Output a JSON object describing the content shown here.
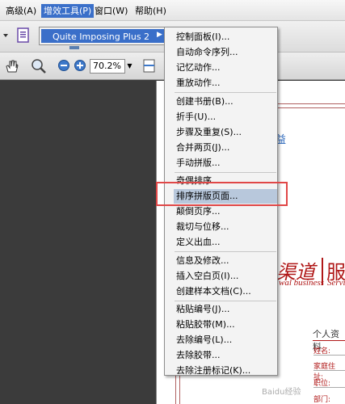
{
  "menubar": {
    "items": [
      "高级(A)",
      "增效工具(P)",
      "窗口(W)",
      "帮助(H)"
    ]
  },
  "toolbar": {
    "zoom_value": "70.2%"
  },
  "submenu": {
    "label": "Quite Imposing Plus 2"
  },
  "menu": {
    "groups": [
      [
        "控制面板(I)...",
        "自动命令序列...",
        "记忆动作...",
        "重放动作..."
      ],
      [
        "创建书册(B)...",
        "折手(U)...",
        "步骤及重复(S)...",
        "合并两页(J)...",
        "手动拼版..."
      ],
      [
        "奇偶排序...",
        "排序拼版页面...",
        "颠倒页序...",
        "裁切与位移...",
        "定义出血..."
      ],
      [
        "信息及修改...",
        "插入空白页(I)...",
        "创建样本文档(C)..."
      ],
      [
        "粘贴编号(J)...",
        "粘贴胶带(M)...",
        "去除编号(L)...",
        "去除胶带...",
        "去除注册标记(K)..."
      ]
    ],
    "selected": "排序拼版页面..."
  },
  "document": {
    "brand_cn": "渠道",
    "brand_cn2": "服",
    "brand_en": "wal business",
    "brand_en2": "Servi",
    "profile_title": "个人资料",
    "fields": [
      "姓名:",
      "家庭住址:",
      "职位:",
      "部门:"
    ]
  },
  "watermark": "Baidu经验"
}
